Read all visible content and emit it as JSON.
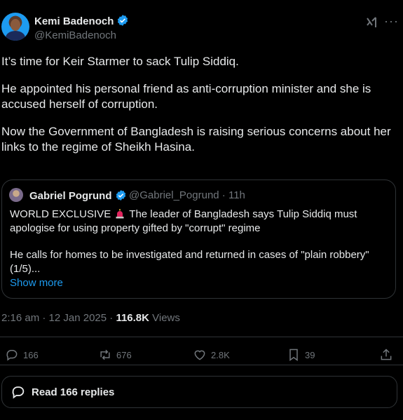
{
  "author": {
    "name": "Kemi Badenoch",
    "handle": "@KemiBadenoch"
  },
  "tweet": {
    "paragraphs": [
      "It’s time for Keir Starmer to sack Tulip Siddiq.",
      "He appointed his personal friend as anti-corruption minister and she is accused herself of corruption.",
      "Now the Government of Bangladesh is raising serious concerns about her links to the regime of Sheikh Hasina."
    ]
  },
  "quote": {
    "name": "Gabriel Pogrund",
    "handle_time": "@Gabriel_Pogrund · 11h",
    "line1_before": "WORLD EXCLUSIVE",
    "line1_after": "The leader of Bangladesh says Tulip Siddiq must apologise for using property gifted by \"corrupt\" regime",
    "line2": "He calls for homes to be investigated and returned in cases of  \"plain robbery\" (1/5)...",
    "show_more": "Show more"
  },
  "meta": {
    "time": "2:16 am · 12 Jan 2025 · ",
    "views_count": "116.8K",
    "views_label": " Views"
  },
  "actions": {
    "replies": "166",
    "reposts": "676",
    "likes": "2.8K",
    "bookmarks": "39"
  },
  "replies_button": "Read 166 replies",
  "colors": {
    "accent": "#1d9bf0",
    "background": "#000000",
    "muted": "#71767b",
    "border": "#2f3336"
  },
  "icons": [
    "verified-badge-icon",
    "grok-icon",
    "more-icon",
    "siren-icon",
    "reply-icon",
    "repost-icon",
    "like-icon",
    "bookmark-icon",
    "share-icon"
  ]
}
